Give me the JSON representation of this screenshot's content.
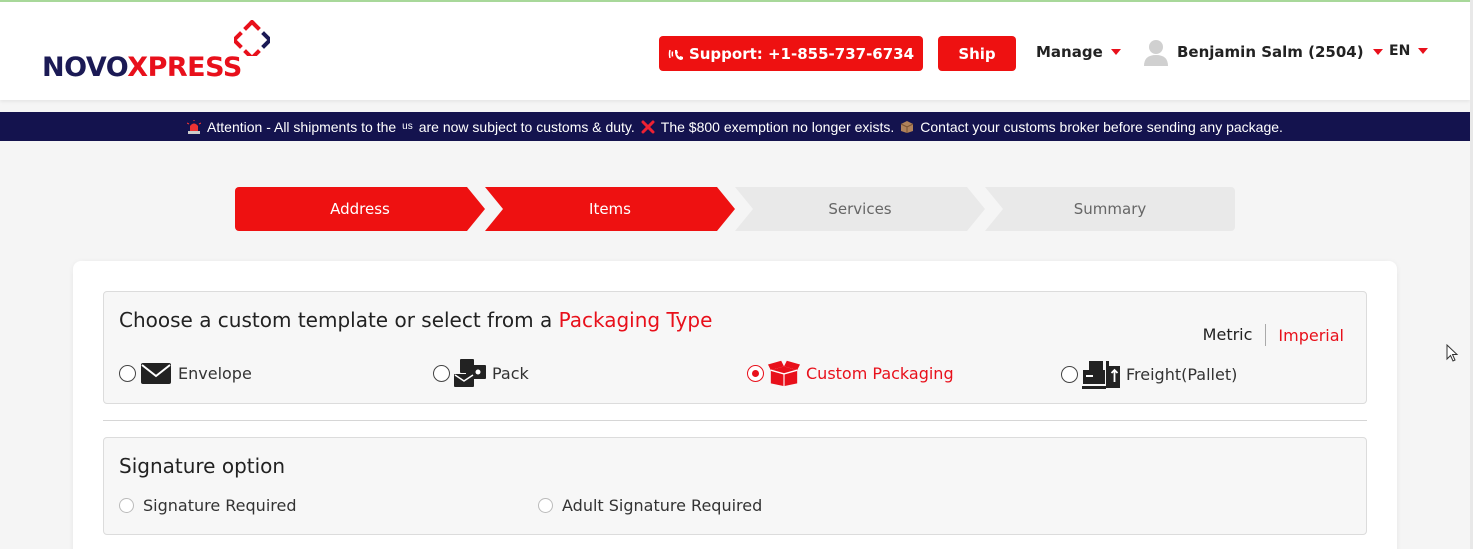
{
  "header": {
    "logo": {
      "part1": "NOVO",
      "part2": "XPRESS"
    },
    "support_label": "Support: +1-855-737-6734",
    "ship_label": "Ship",
    "manage_label": "Manage",
    "user_label": "Benjamin Salm (2504)",
    "lang_label": "EN"
  },
  "banner": {
    "part1": "Attention - All shipments to the",
    "us": "us",
    "part2": "are now subject to customs & duty.",
    "part3": "The $800 exemption no longer exists.",
    "part4": "Contact your customs broker before sending any package."
  },
  "stepper": {
    "steps": [
      {
        "label": "Address",
        "state": "done"
      },
      {
        "label": "Items",
        "state": "active"
      },
      {
        "label": "Services",
        "state": "pending"
      },
      {
        "label": "Summary",
        "state": "pending"
      }
    ]
  },
  "packaging": {
    "title_prefix": "Choose a custom template or select from a",
    "title_accent": "Packaging Type",
    "units": {
      "metric": "Metric",
      "imperial": "Imperial",
      "selected": "Imperial"
    },
    "options": [
      {
        "label": "Envelope",
        "icon": "envelope-icon",
        "selected": false
      },
      {
        "label": "Pack",
        "icon": "pack-icon",
        "selected": false
      },
      {
        "label": "Custom Packaging",
        "icon": "open-box-icon",
        "selected": true
      },
      {
        "label": "Freight(Pallet)",
        "icon": "freight-icon",
        "selected": false
      }
    ]
  },
  "signature": {
    "title": "Signature option",
    "options": [
      {
        "label": "Signature Required"
      },
      {
        "label": "Adult Signature Required"
      }
    ]
  },
  "colors": {
    "brand_red": "#ee1111",
    "brand_navy": "#1b1a55",
    "banner_bg": "#14134e",
    "pending_step": "#e9e9e9"
  }
}
